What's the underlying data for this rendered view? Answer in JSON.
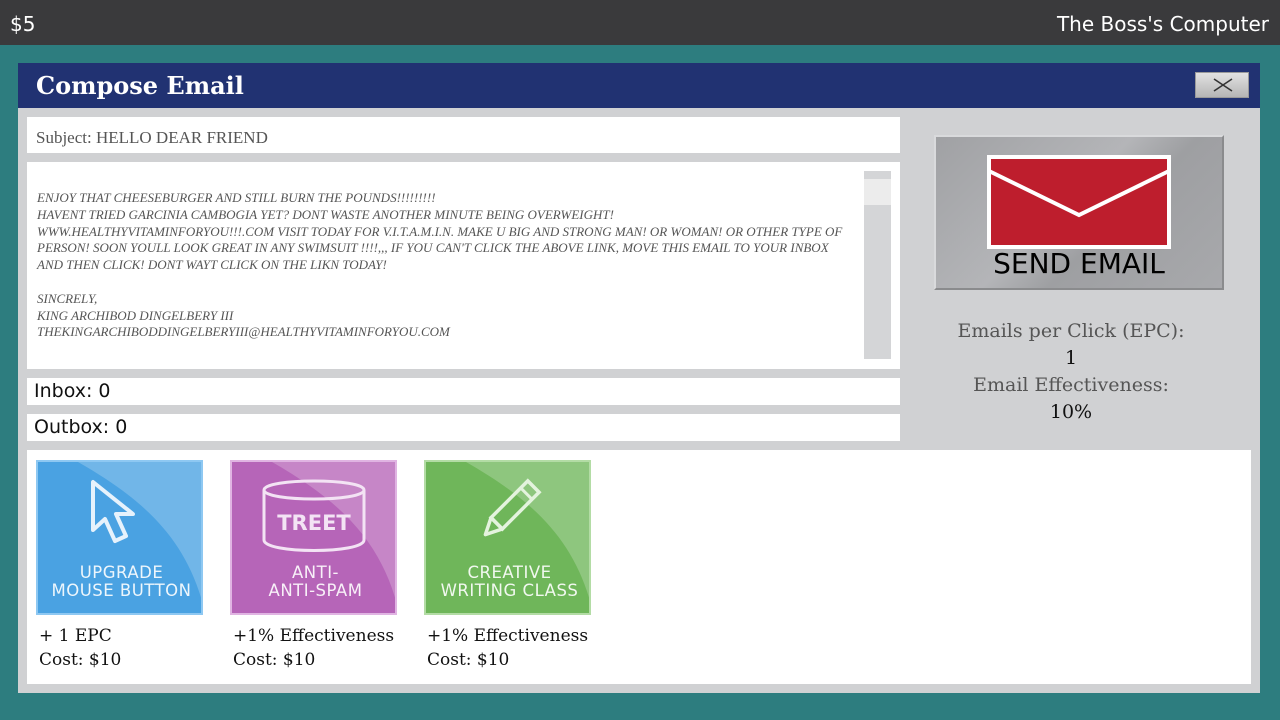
{
  "topbar": {
    "money": "$5",
    "title": "The Boss's Computer"
  },
  "window": {
    "title": "Compose Email",
    "close_icon": "close-icon"
  },
  "email": {
    "subject": "Subject: HELLO DEAR FRIEND",
    "body": "ENJOY THAT CHEESEBURGER AND STILL BURN THE POUNDS!!!!!!!!!\nHAVENT TRIED GARCINIA CAMBOGIA YET? DONT WASTE ANOTHER MINUTE BEING OVERWEIGHT!\nWWW.HEALTHYVITAMINFORYOU!!!.COM VISIT TODAY FOR V.I.T.A.M.I.N. MAKE U BIG AND STRONG MAN! OR WOMAN! OR OTHER TYPE OF PERSON! SOON YOULL LOOK GREAT IN ANY SWIMSUIT !!!!,,, IF YOU CAN'T CLICK THE ABOVE LINK, MOVE THIS EMAIL TO YOUR INBOX AND THEN CLICK! DONT WAYT CLICK ON THE LIKN TODAY!\n\nSINCRELY,\nKING ARCHIBOD DINGELBERY III\nTHEKINGARCHIBODDINGELBERYIII@HEALTHYVITAMINFORYOU.COM"
  },
  "inbox": "Inbox: 0",
  "outbox": "Outbox: 0",
  "send": {
    "label": "SEND EMAIL",
    "icon": "envelope-icon",
    "envelope_color": "#be1e2d"
  },
  "stats": {
    "epc_label": "Emails per Click (EPC):",
    "epc_value": "1",
    "effectiveness_label": "Email Effectiveness:",
    "effectiveness_value": "10%"
  },
  "upgrades": [
    {
      "label": "UPGRADE\nMOUSE BUTTON",
      "icon": "cursor-icon",
      "effect": "+ 1 EPC",
      "cost": "Cost: $10",
      "color": "#4fa3e3"
    },
    {
      "label": "ANTI-\nANTI-SPAM",
      "icon": "treet-can-icon",
      "icon_text": "TREET",
      "effect": "+1% Effectiveness",
      "cost": "Cost: $10",
      "color": "#c27fc5"
    },
    {
      "label": "CREATIVE\nWRITING CLASS",
      "icon": "pencil-icon",
      "effect": "+1% Effectiveness",
      "cost": "Cost: $10",
      "color": "#79bb65"
    }
  ]
}
